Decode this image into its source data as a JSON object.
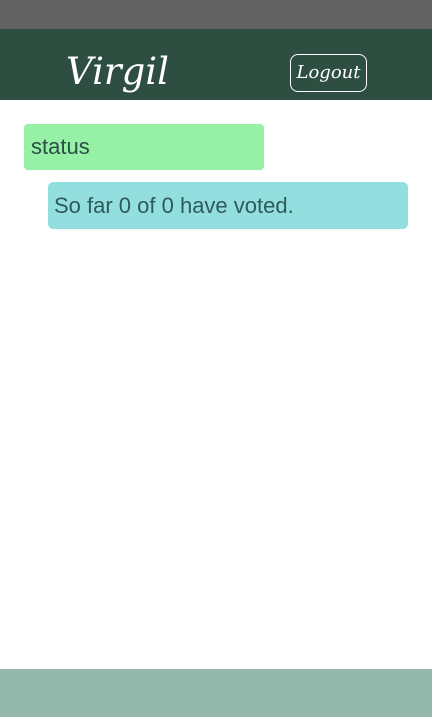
{
  "header": {
    "title": "Virgil",
    "logout_label": "Logout"
  },
  "status": {
    "label": "status",
    "message": "So far 0 of 0 have voted."
  },
  "colors": {
    "system_bar": "#626262",
    "header_bg": "#2e4e42",
    "status_label_bg": "#96f0a6",
    "status_message_bg": "#93dfe0",
    "footer_bg": "#93b7ab"
  }
}
